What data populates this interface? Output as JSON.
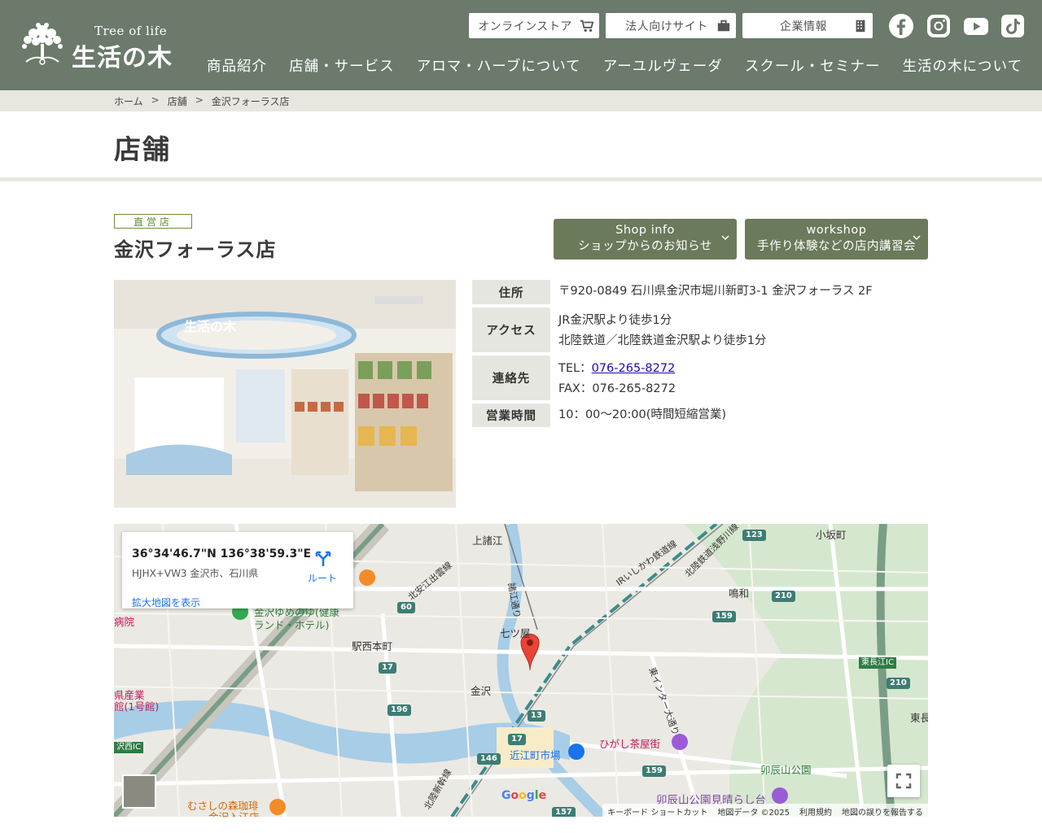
{
  "header": {
    "logo_en": "Tree of life",
    "logo_jp": "生活の木",
    "top_buttons": [
      {
        "label": "オンラインストア",
        "icon": "cart-icon"
      },
      {
        "label": "法人向けサイト",
        "icon": "briefcase-icon"
      },
      {
        "label": "企業情報",
        "icon": "building-icon"
      }
    ],
    "social": [
      "facebook-icon",
      "instagram-icon",
      "youtube-icon",
      "tiktok-icon"
    ],
    "nav": [
      "商品紹介",
      "店舗・サービス",
      "アロマ・ハーブについて",
      "アーユルヴェーダ",
      "スクール・セミナー",
      "生活の木について"
    ],
    "colors": {
      "header_bg": "#6b7a6b",
      "button_bg": "#6b7a5a"
    }
  },
  "breadcrumb": [
    "ホーム",
    "店舗",
    "金沢フォーラス店"
  ],
  "page_title": "店舗",
  "store": {
    "badge": "直営店",
    "name": "金沢フォーラス店",
    "buttons": [
      {
        "line1": "Shop info",
        "line2": "ショップからのお知らせ"
      },
      {
        "line1": "workshop",
        "line2": "手作り体験などの店内講習会"
      }
    ],
    "info": {
      "address_label": "住所",
      "address": "〒920-0849 石川県金沢市堀川新町3-1 金沢フォーラス 2F",
      "access_label": "アクセス",
      "access": [
        "JR金沢駅より徒歩1分",
        "北陸鉄道／北陸鉄道金沢駅より徒歩1分"
      ],
      "contact_label": "連絡先",
      "tel_prefix": "TEL：",
      "tel": "076-265-8272",
      "fax": "FAX：076-265-8272",
      "hours_label": "営業時間",
      "hours": "10：00～20:00(時間短縮営業)"
    }
  },
  "map": {
    "coord": "36°34'46.7\"N 136°38'59.3\"E",
    "plus_code": "HJHX+VW3 金沢市、石川県",
    "route": "ルート",
    "enlarge": "拡大地図を表示",
    "labels": {
      "kamiseki": "上諸江",
      "kosaka": "小坂町",
      "naruwa": "鳴和",
      "shichikuya": "七ツ屋",
      "ekinishi": "駅西本町",
      "kanazawa": "金沢",
      "higashi": "ひがし茶屋街",
      "omicho": "近江町市場",
      "utatsu": "卯辰山公園",
      "utatsu_view": "卯辰山公園見晴らし台",
      "musashi": "むさしの森珈琲",
      "musashi2": "金沢入江店",
      "hotel": "金沢ゆめのゆ(健康",
      "hotel2": "ランド・ホテル)",
      "irline": "IRいしかわ鉄道線",
      "hokutetsu": "北陸鉄道浅野川線",
      "kitayasue": "北安江出雲線",
      "moroe": "諸江通り",
      "higashi_inter": "東インター大通り",
      "shinkansen": "北陸新幹線",
      "higashi_ic": "東長江IC",
      "nishi_ic": "沢西IC",
      "byoin": "病院",
      "sangyo": "県産業",
      "sangyo2": "館(1号館)",
      "higashi_r": "東長"
    },
    "footer": [
      "キーボード ショートカット",
      "地図データ ©2025",
      "利用規約",
      "地図の誤りを報告する"
    ],
    "google": "Google"
  }
}
